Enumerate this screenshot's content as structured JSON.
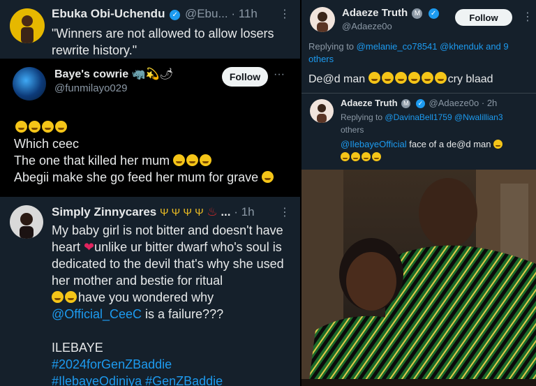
{
  "tweet1": {
    "name": "Ebuka Obi-Uchendu",
    "handle": "@Ebu...",
    "time": "· 11h",
    "text": "\"Winners are not allowed to allow losers rewrite history.\""
  },
  "tweet2": {
    "name": "Baye's cowrie",
    "handle": "@funmilayo029",
    "follow_label": "Follow",
    "more": "···",
    "line1": "Which ceec",
    "line2": "The one that killed her mum",
    "line3": "Abegii make she go feed her mum for grave"
  },
  "tweet3": {
    "name": "Simply Zinnycares",
    "name_suffix": "...",
    "time": "· 1h",
    "body1": "My baby girl is not bitter and doesn't have heart",
    "body2": "unlike ur bitter dwarf who's soul is dedicated to the devil that's why she used her mother and bestie for ritual",
    "body3": "have you wondered why",
    "mention": "@Official_CeeC",
    "body4": "is a failure???",
    "tag_line1": "ILEBAYE",
    "tag_line2": "#2024forGenZBaddie",
    "tag_line3": "#IlebayeOdiniya #GenZBaddie"
  },
  "right": {
    "name": "Adaeze Truth",
    "handle": "@Adaeze0o",
    "follow_label": "Follow",
    "replying_prefix": "Replying to",
    "replying_mentions": "@melanie_co78541 @khenduk",
    "replying_suffix": "and 9 others",
    "text": "De@d man",
    "text_tail": "cry blaad",
    "reply": {
      "name": "Adaeze Truth",
      "handle": "@Adaeze0o",
      "time": "· 2h",
      "replying_prefix": "Replying to",
      "replying_mentions": "@DavinaBell1759 @Nwalillian3",
      "replying_suffix": "others",
      "mention": "@IlebayeOfficial",
      "text": "face of a de@d man"
    }
  },
  "colors": {
    "background": "#15202b",
    "accent": "#1d9bf0",
    "text": "#e7e9ea",
    "muted": "#8b98a5"
  }
}
